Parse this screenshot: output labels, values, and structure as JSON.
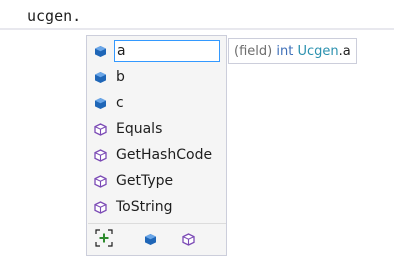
{
  "editor": {
    "code_text": "ucgen."
  },
  "completion": {
    "items": [
      {
        "label": "a",
        "kind": "field",
        "icon": "field-icon"
      },
      {
        "label": "b",
        "kind": "field",
        "icon": "field-icon"
      },
      {
        "label": "c",
        "kind": "field",
        "icon": "field-icon"
      },
      {
        "label": "Equals",
        "kind": "method",
        "icon": "method-icon"
      },
      {
        "label": "GetHashCode",
        "kind": "method",
        "icon": "method-icon"
      },
      {
        "label": "GetType",
        "kind": "method",
        "icon": "method-icon"
      },
      {
        "label": "ToString",
        "kind": "method",
        "icon": "method-icon"
      }
    ],
    "selected_index": 0,
    "filters": [
      {
        "name": "expand-filter-icon"
      },
      {
        "name": "field-filter-icon"
      },
      {
        "name": "method-filter-icon"
      }
    ]
  },
  "tooltip": {
    "prefix": "(field)",
    "keyword": "int",
    "type_name": "Ucgen",
    "member": ".a"
  },
  "colors": {
    "field_icon": "#1f66b7",
    "method_icon": "#7b4ab5",
    "selection_border": "#3399ff",
    "expand_icon": "#2e8b2e"
  }
}
